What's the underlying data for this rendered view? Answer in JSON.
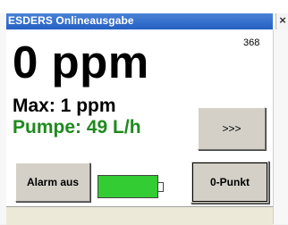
{
  "window": {
    "title": "ESDERS Onlineausgabe",
    "close_glyph": "×"
  },
  "display": {
    "counter": "368",
    "reading": "0 ppm",
    "max": "Max: 1 ppm",
    "pump": "Pumpe: 49 L/h"
  },
  "buttons": {
    "next_label": ">>>",
    "alarm_label": "Alarm aus",
    "zero_label": "0-Punkt"
  },
  "battery": {
    "level_fraction": 1.0,
    "fill_color": "#33cc33"
  },
  "colors": {
    "title_bar": "#2f6ad0",
    "pump_text": "#1e8a1e"
  }
}
